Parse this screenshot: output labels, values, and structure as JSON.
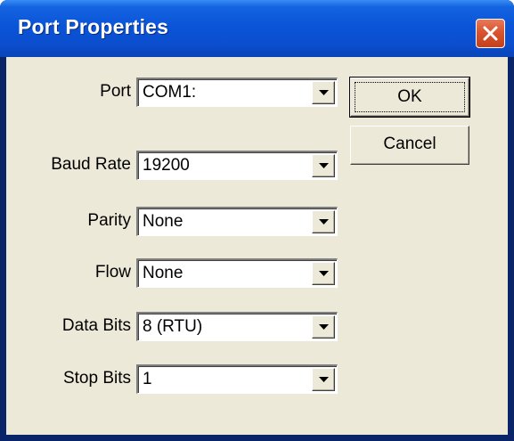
{
  "window": {
    "title": "Port Properties"
  },
  "icons": {
    "close": "close-icon",
    "dropdown": "chevron-down-icon"
  },
  "colors": {
    "titlebar": "#0a54d8",
    "close_button": "#d8552f",
    "client_background": "#ece9d8"
  },
  "fields": [
    {
      "label": "Port",
      "value": "COM1:"
    },
    {
      "label": "Baud Rate",
      "value": "19200"
    },
    {
      "label": "Parity",
      "value": "None"
    },
    {
      "label": "Flow",
      "value": "None"
    },
    {
      "label": "Data Bits",
      "value": "8 (RTU)"
    },
    {
      "label": "Stop Bits",
      "value": "1"
    }
  ],
  "buttons": {
    "ok_label": "OK",
    "cancel_label": "Cancel"
  }
}
